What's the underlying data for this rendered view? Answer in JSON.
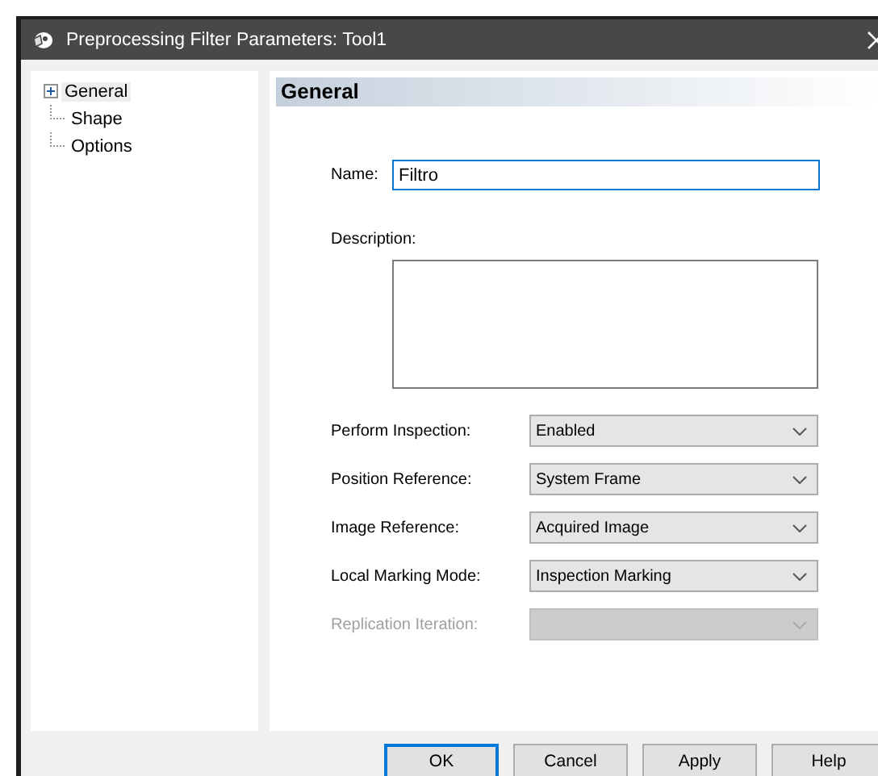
{
  "window": {
    "title": "Preprocessing Filter Parameters: Tool1"
  },
  "tree": [
    {
      "label": "General",
      "expanded": false,
      "selected": true
    },
    {
      "label": "Shape",
      "selected": false
    },
    {
      "label": "Options",
      "selected": false
    }
  ],
  "panel": {
    "heading": "General",
    "name": {
      "label": "Name:",
      "value": "Filtro"
    },
    "description": {
      "label": "Description:"
    },
    "dropdowns": [
      {
        "label": "Perform Inspection:",
        "value": "Enabled",
        "disabled": false
      },
      {
        "label": "Position Reference:",
        "value": "System Frame",
        "disabled": false
      },
      {
        "label": "Image Reference:",
        "value": "Acquired Image",
        "disabled": false
      },
      {
        "label": "Local Marking Mode:",
        "value": "Inspection Marking",
        "disabled": false
      },
      {
        "label": "Replication Iteration:",
        "disabled": true
      }
    ]
  },
  "buttons": [
    {
      "label": "OK",
      "default": true
    },
    {
      "label": "Cancel",
      "default": false
    },
    {
      "label": "Apply",
      "default": false
    },
    {
      "label": "Help",
      "default": false
    }
  ]
}
